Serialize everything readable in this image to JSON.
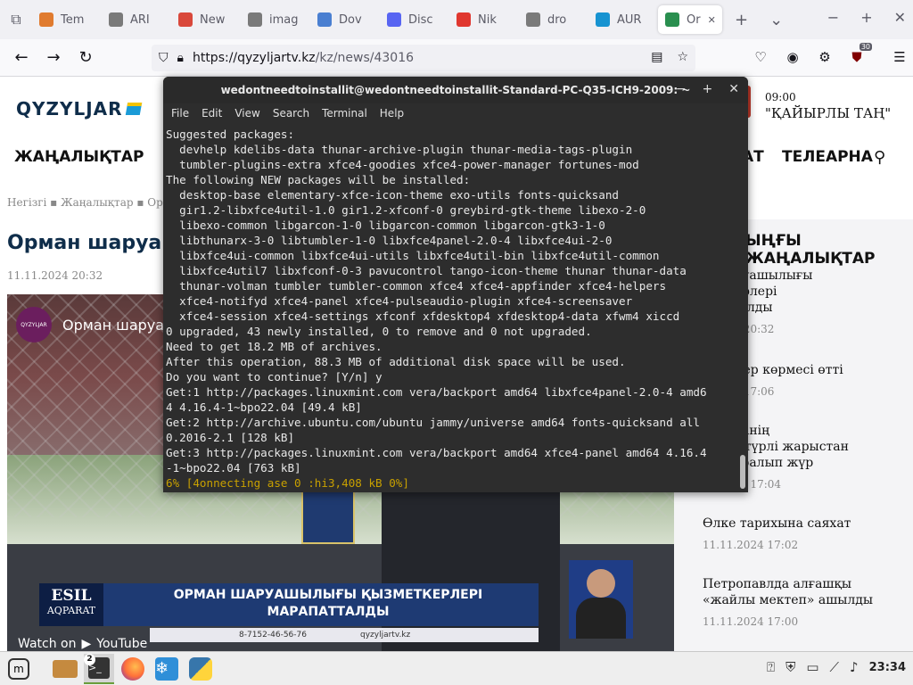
{
  "browser": {
    "tabs": [
      {
        "label": "Tem",
        "color": "#e07b2f"
      },
      {
        "label": "ARI",
        "color": "#7a7a7a"
      },
      {
        "label": "New",
        "color": "#d9483b"
      },
      {
        "label": "imag",
        "color": "#7a7a7a"
      },
      {
        "label": "Dov",
        "color": "#4a7fd1"
      },
      {
        "label": "Disc",
        "color": "#5865f2"
      },
      {
        "label": "Nik",
        "color": "#e0372f"
      },
      {
        "label": "dro",
        "color": "#7a7a7a"
      },
      {
        "label": "AUR",
        "color": "#1793d1"
      },
      {
        "label": "Or",
        "color": "#2a8f4f"
      }
    ],
    "url_host": "https://qyzyljartv.kz",
    "url_path": "/kz/news/43016",
    "ext_badge": "30"
  },
  "site": {
    "logo": "QYZYLJAR",
    "on_air_time": "09:00",
    "on_air_show": "\"ҚАЙЫРЛЫ ТАҢ\"",
    "menu": {
      "news": "ЖАҢАЛЫҚТАР",
      "partial": "АТ",
      "tv": "ТЕЛЕАРНА"
    },
    "breadcrumbs": "Негізгі  ▪  Жаңалықтар  ▪  Орм",
    "article_title": "Орман шаруа",
    "article_date": "11.11.2024 20:32",
    "video": {
      "channel_title": "Орман шаруа",
      "avatar_text": "QYZYLJAR",
      "esil1": "ESIL",
      "esil2": "AQPARAT",
      "lower_text": "ОРМАН ШАРУАШЫЛЫҒЫ ҚЫЗМЕТКЕРЛЕРІ МАРАПАТТАЛДЫ",
      "phone": "8-7152-46-56-76",
      "web": "qyzyljartv.kz",
      "watch_on": "Watch on",
      "youtube": "YouTube"
    },
    "sidebar": {
      "title": "ЫҢҒЫ ЖАҢАЛЫҚТАР",
      "items": [
        {
          "title": "н шаруашылығы\nметкерлері\nапатталды",
          "date": "1.2024 20:32"
        },
        {
          "title": "илиндер көрмесі өтті",
          "date": "1.2024 17:06"
        },
        {
          "title": "ұғалімінің\nштері түрлі жарыстан\nжен оралып жүр",
          "date": "11.2024 17:04"
        },
        {
          "title": "Өлке тарихына саяхат",
          "date": "11.11.2024 17:02"
        },
        {
          "title": "Петропавлда алғашқы\n«жайлы мектеп» ашылды",
          "date": "11.11.2024 17:00"
        }
      ]
    }
  },
  "terminal": {
    "title": "wedontneedtoinstallit@wedontneedtoinstallit-Standard-PC-Q35-ICH9-2009: ~",
    "menu": [
      "File",
      "Edit",
      "View",
      "Search",
      "Terminal",
      "Help"
    ],
    "lines": [
      "Suggested packages:",
      "  devhelp kdelibs-data thunar-archive-plugin thunar-media-tags-plugin",
      "  tumbler-plugins-extra xfce4-goodies xfce4-power-manager fortunes-mod",
      "The following NEW packages will be installed:",
      "  desktop-base elementary-xfce-icon-theme exo-utils fonts-quicksand",
      "  gir1.2-libxfce4util-1.0 gir1.2-xfconf-0 greybird-gtk-theme libexo-2-0",
      "  libexo-common libgarcon-1-0 libgarcon-common libgarcon-gtk3-1-0",
      "  libthunarx-3-0 libtumbler-1-0 libxfce4panel-2.0-4 libxfce4ui-2-0",
      "  libxfce4ui-common libxfce4ui-utils libxfce4util-bin libxfce4util-common",
      "  libxfce4util7 libxfconf-0-3 pavucontrol tango-icon-theme thunar thunar-data",
      "  thunar-volman tumbler tumbler-common xfce4 xfce4-appfinder xfce4-helpers",
      "  xfce4-notifyd xfce4-panel xfce4-pulseaudio-plugin xfce4-screensaver",
      "  xfce4-session xfce4-settings xfconf xfdesktop4 xfdesktop4-data xfwm4 xiccd",
      "0 upgraded, 43 newly installed, 0 to remove and 0 not upgraded.",
      "Need to get 18.2 MB of archives.",
      "After this operation, 88.3 MB of additional disk space will be used.",
      "Do you want to continue? [Y/n] y",
      "Get:1 http://packages.linuxmint.com vera/backport amd64 libxfce4panel-2.0-4 amd6",
      "4 4.16.4-1~bpo22.04 [49.4 kB]",
      "Get:2 http://archive.ubuntu.com/ubuntu jammy/universe amd64 fonts-quicksand all",
      "0.2016-2.1 [128 kB]",
      "Get:3 http://packages.linuxmint.com vera/backport amd64 xfce4-panel amd64 4.16.4",
      "-1~bpo22.04 [763 kB]"
    ],
    "progress": "6% [4onnecting ase 0 :hi3,408 kB 0%]"
  },
  "taskbar": {
    "terminal_badge": "2",
    "clock": "23:34"
  }
}
